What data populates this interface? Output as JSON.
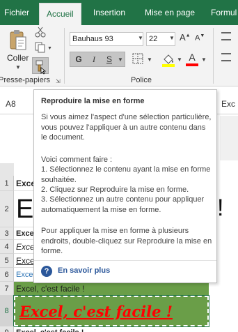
{
  "tabs": [
    {
      "label": "Fichier",
      "active": false
    },
    {
      "label": "Accueil",
      "active": true
    },
    {
      "label": "Insertion",
      "active": false
    },
    {
      "label": "Mise en page",
      "active": false
    },
    {
      "label": "Formul",
      "active": false
    }
  ],
  "ribbon": {
    "paste_label": "Coller",
    "clipboard_group": "Presse-papiers",
    "font_group": "Police",
    "font_name": "Bauhaus 93",
    "font_size": "22",
    "bold": "G",
    "italic": "I",
    "underline": "S",
    "fill_color": "#ffff00",
    "font_color": "#ff0000"
  },
  "formula_bar": {
    "cell_ref": "A8",
    "content_partial": "Exc"
  },
  "tooltip": {
    "title": "Reproduire la mise en forme",
    "para1": "Si vous aimez l'aspect d'une sélection particulière, vous pouvez l'appliquer à un autre contenu dans le document.",
    "howto_title": "Voici comment faire :",
    "steps": [
      "1. Sélectionnez le contenu ayant la mise en forme souhaitée.",
      "2. Cliquez sur Reproduire la mise en forme.",
      "3. Sélectionnez un autre contenu pour appliquer automatiquement la mise en forme."
    ],
    "para3": "Pour appliquer la mise en forme à plusieurs endroits, double-cliquez sur Reproduire la mise en forme.",
    "link": "En savoir plus"
  },
  "rows": [
    {
      "num": "1",
      "text": "Exce"
    },
    {
      "num": "2",
      "text": "E",
      "right_char": "!"
    },
    {
      "num": "3",
      "text": "Excel"
    },
    {
      "num": "4",
      "text": "Exce"
    },
    {
      "num": "5",
      "text": "Exce"
    },
    {
      "num": "6",
      "text": "Excel"
    },
    {
      "num": "7",
      "text": "Excel, c'est facile !"
    },
    {
      "num": "8",
      "text": "Excel, c'est facile !"
    },
    {
      "num": "9",
      "text": "Excel, c'est facile !"
    }
  ],
  "colors": {
    "excel_green": "#217346",
    "row7_fill": "#6a9e48",
    "row8_text": "#ff0000",
    "row6_text": "#2e75b6",
    "link": "#2b579a"
  }
}
